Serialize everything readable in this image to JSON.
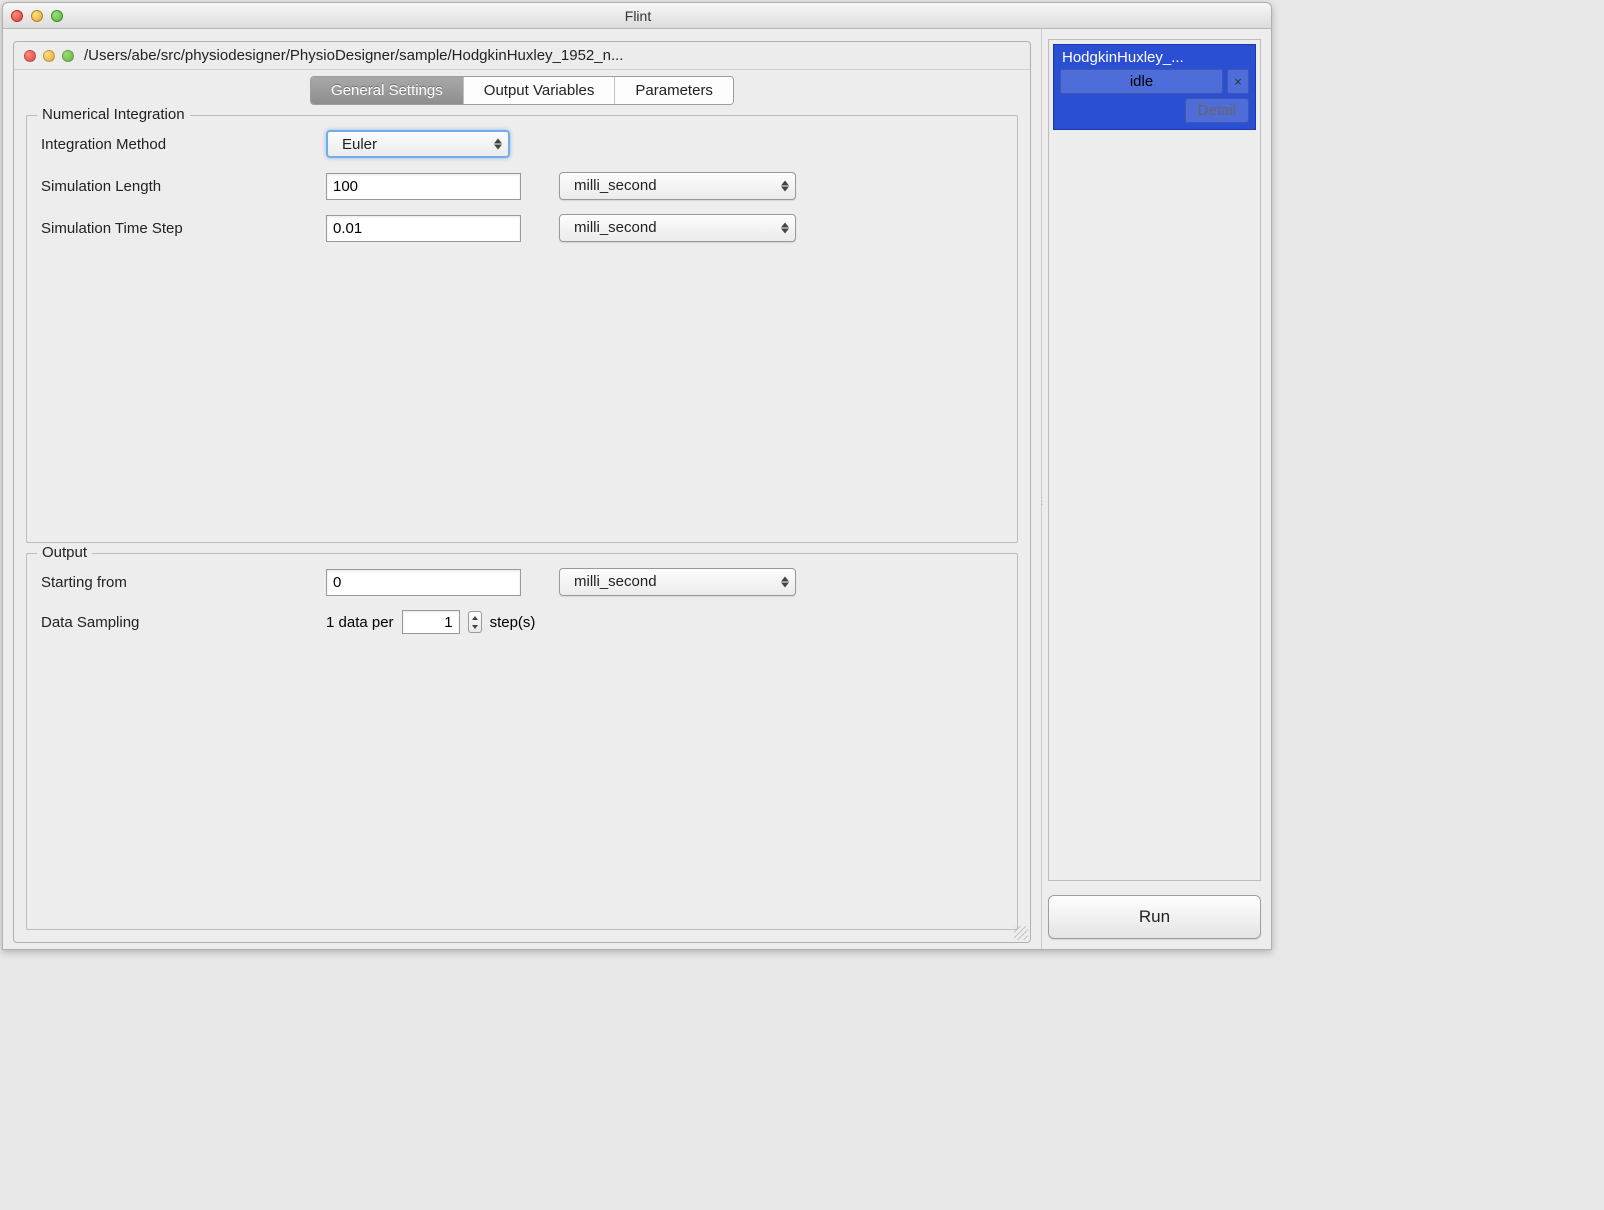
{
  "window": {
    "app_title": "Flint"
  },
  "inner_window": {
    "path": "/Users/abe/src/physiodesigner/PhysioDesigner/sample/HodgkinHuxley_1952_n..."
  },
  "tabs": {
    "general": "General Settings",
    "output_vars": "Output Variables",
    "parameters": "Parameters"
  },
  "numerical": {
    "legend": "Numerical Integration",
    "integration_method_label": "Integration Method",
    "integration_method_value": "Euler",
    "sim_length_label": "Simulation Length",
    "sim_length_value": "100",
    "sim_length_unit": "milli_second",
    "sim_step_label": "Simulation Time Step",
    "sim_step_value": "0.01",
    "sim_step_unit": "milli_second"
  },
  "output": {
    "legend": "Output",
    "starting_from_label": "Starting from",
    "starting_from_value": "0",
    "starting_from_unit": "milli_second",
    "data_sampling_label": "Data Sampling",
    "data_sampling_prefix": "1 data per",
    "data_sampling_value": "1",
    "data_sampling_suffix": "step(s)"
  },
  "sidebar": {
    "sim_name": "HodgkinHuxley_...",
    "status": "idle",
    "close_glyph": "×",
    "detail": "Detail"
  },
  "buttons": {
    "run": "Run"
  }
}
